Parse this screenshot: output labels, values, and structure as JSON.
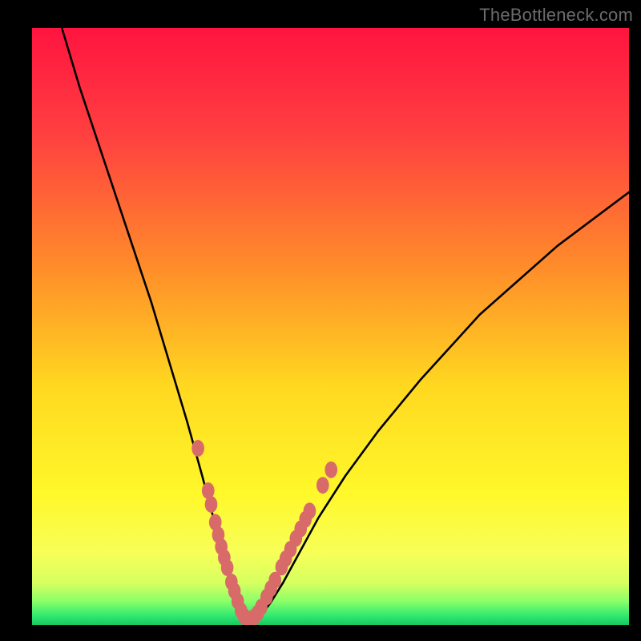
{
  "watermark": "TheBottleneck.com",
  "colors": {
    "bg": "#000000",
    "curve": "#000000",
    "marker": "#d86a6a",
    "gradient_stops": [
      {
        "offset": 0.0,
        "color": "#ff1440"
      },
      {
        "offset": 0.18,
        "color": "#ff4040"
      },
      {
        "offset": 0.4,
        "color": "#ff8c2a"
      },
      {
        "offset": 0.6,
        "color": "#ffd820"
      },
      {
        "offset": 0.78,
        "color": "#fff82a"
      },
      {
        "offset": 0.88,
        "color": "#f7ff58"
      },
      {
        "offset": 0.93,
        "color": "#d6ff60"
      },
      {
        "offset": 0.96,
        "color": "#8cff68"
      },
      {
        "offset": 0.985,
        "color": "#30e870"
      },
      {
        "offset": 1.0,
        "color": "#18c860"
      }
    ]
  },
  "chart_data": {
    "type": "line",
    "title": "",
    "xlabel": "",
    "ylabel": "",
    "xlim": [
      0,
      100
    ],
    "ylim": [
      0,
      100
    ],
    "series": [
      {
        "name": "bottleneck-curve",
        "x": [
          5,
          8,
          12,
          16,
          20,
          23,
          26,
          28.5,
          30.5,
          32,
          33.3,
          34.3,
          35.2,
          36,
          37,
          38.5,
          40,
          42,
          45,
          48,
          52.5,
          58,
          65,
          75,
          88,
          100
        ],
        "y": [
          100,
          90,
          78,
          66,
          54,
          44,
          34,
          25,
          17.5,
          11.5,
          7,
          3.8,
          1.8,
          0.9,
          0.9,
          1.8,
          3.8,
          7.0,
          12.5,
          18,
          25,
          32.5,
          41,
          52,
          63.5,
          72.5
        ]
      }
    ],
    "markers": {
      "name": "highlight-band",
      "xy": [
        [
          27.8,
          29.6
        ],
        [
          29.5,
          22.5
        ],
        [
          30.0,
          20.2
        ],
        [
          30.7,
          17.2
        ],
        [
          31.2,
          15.1
        ],
        [
          31.7,
          13.1
        ],
        [
          32.2,
          11.3
        ],
        [
          32.7,
          9.6
        ],
        [
          33.4,
          7.2
        ],
        [
          33.9,
          5.7
        ],
        [
          34.45,
          4.0
        ],
        [
          35.0,
          2.4
        ],
        [
          35.5,
          1.5
        ],
        [
          36.0,
          1.0
        ],
        [
          36.6,
          1.0
        ],
        [
          37.2,
          1.3
        ],
        [
          37.8,
          2.0
        ],
        [
          38.4,
          3.0
        ],
        [
          39.3,
          4.7
        ],
        [
          40.0,
          6.1
        ],
        [
          40.7,
          7.5
        ],
        [
          41.8,
          9.7
        ],
        [
          42.5,
          11.1
        ],
        [
          43.3,
          12.7
        ],
        [
          44.2,
          14.5
        ],
        [
          45.0,
          16.1
        ],
        [
          45.8,
          17.7
        ],
        [
          46.5,
          19.1
        ],
        [
          48.7,
          23.4
        ],
        [
          50.1,
          26.0
        ]
      ]
    }
  }
}
